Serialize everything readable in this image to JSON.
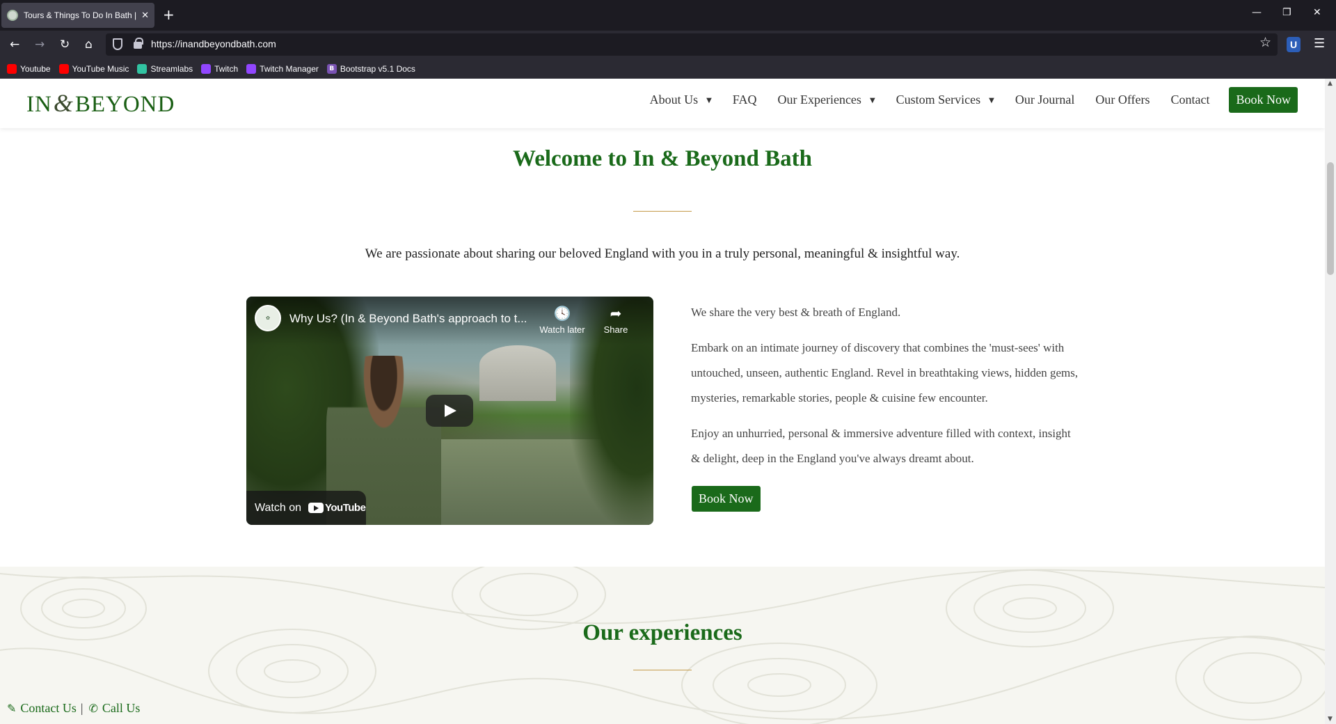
{
  "browser": {
    "tab_title": "Tours & Things To Do In Bath | S",
    "url": "https://inandbeyondbath.com",
    "extension_badge": "U",
    "bookmarks": [
      {
        "label": "Youtube",
        "color": "#ff0000"
      },
      {
        "label": "YouTube Music",
        "color": "#ff0000"
      },
      {
        "label": "Streamlabs",
        "color": "#31c3a2"
      },
      {
        "label": "Twitch",
        "color": "#9146ff"
      },
      {
        "label": "Twitch Manager",
        "color": "#9146ff"
      },
      {
        "label": "Bootstrap v5.1 Docs",
        "color": "#7952b3",
        "glyph": "B"
      }
    ]
  },
  "header": {
    "logo_left": "IN",
    "logo_amp": "&",
    "logo_right": "BEYOND",
    "nav": [
      {
        "label": "About Us",
        "has_dropdown": true
      },
      {
        "label": "FAQ",
        "has_dropdown": false
      },
      {
        "label": "Our Experiences",
        "has_dropdown": true
      },
      {
        "label": "Custom Services",
        "has_dropdown": true
      },
      {
        "label": "Our Journal",
        "has_dropdown": false
      },
      {
        "label": "Our Offers",
        "has_dropdown": false
      },
      {
        "label": "Contact",
        "has_dropdown": false
      }
    ],
    "book_now": "Book Now"
  },
  "welcome": {
    "title": "Welcome to In & Beyond Bath",
    "intro": "We are passionate about sharing our beloved England with you in a truly personal, meaningful & insightful way."
  },
  "video": {
    "title": "Why Us? (In & Beyond Bath's approach to t...",
    "watch_later": "Watch later",
    "share": "Share",
    "watch_on": "Watch on",
    "youtube": "YouTube"
  },
  "about": {
    "paragraphs": [
      "We share the very best & breath of England.",
      "Embark on an intimate journey of discovery that combines the 'must-sees' with untouched, unseen, authentic England. Revel in breathtaking views, hidden gems, mysteries, remarkable stories, people & cuisine few encounter.",
      "Enjoy an unhurried, personal & immersive adventure filled with context, insight & delight, deep in the England you've always dreamt about."
    ],
    "book_now": "Book Now"
  },
  "experiences": {
    "title": "Our experiences"
  },
  "footer": {
    "contact_us": "Contact Us",
    "separator": "|",
    "call_us": "Call Us"
  },
  "colors": {
    "brand_green": "#1a6a1a",
    "divider_gold": "#c49a4a"
  }
}
